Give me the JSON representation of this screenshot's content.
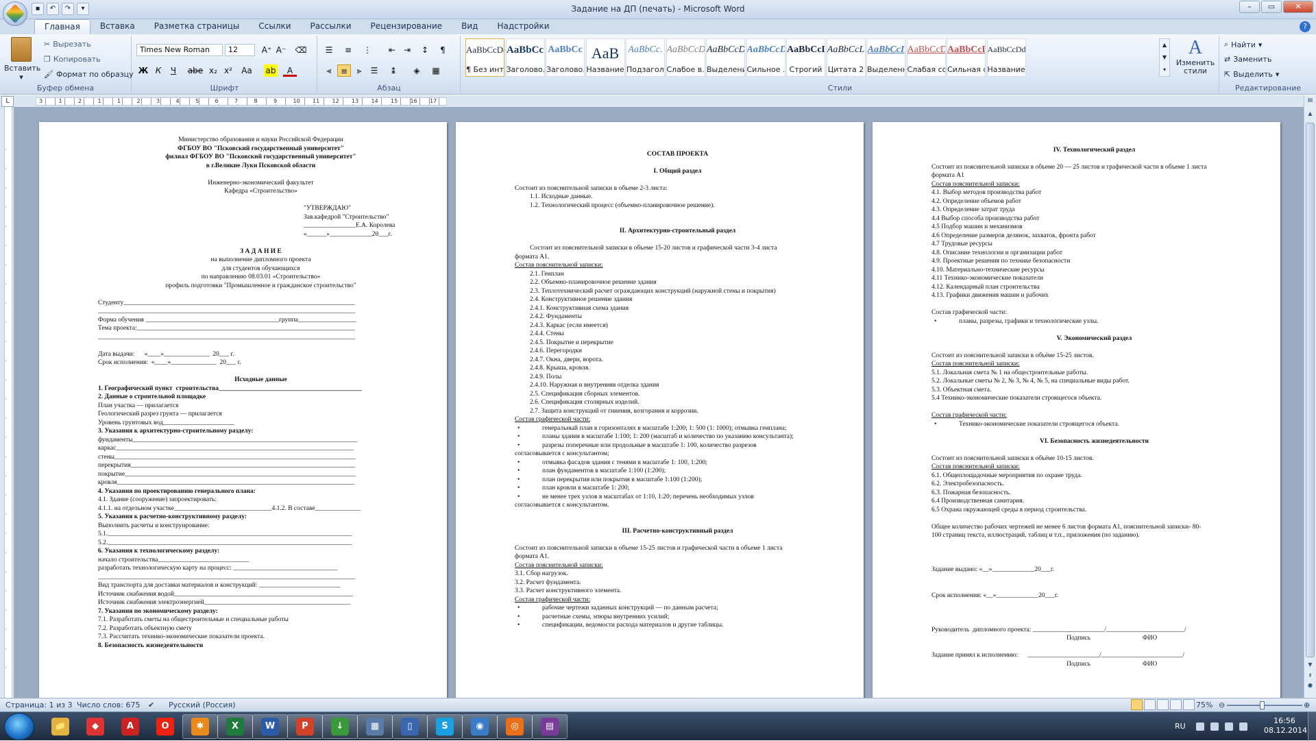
{
  "window": {
    "title": "Задание на ДП (печать) - Microsoft Word"
  },
  "tabs": [
    "Главная",
    "Вставка",
    "Разметка страницы",
    "Ссылки",
    "Рассылки",
    "Рецензирование",
    "Вид",
    "Надстройки"
  ],
  "ribbon": {
    "clipboard": {
      "label": "Буфер обмена",
      "paste": "Вставить",
      "cut": "Вырезать",
      "copy": "Копировать",
      "format_painter": "Формат по образцу"
    },
    "font": {
      "label": "Шрифт",
      "family": "Times New Roman",
      "size": "12",
      "buttons": [
        "Ж",
        "К",
        "Ч",
        "abe",
        "x₂",
        "x²",
        "Aa"
      ]
    },
    "paragraph": {
      "label": "Абзац"
    },
    "styles": {
      "label": "Стили",
      "change": "Изменить стили",
      "items": [
        {
          "sample": "AaBbCcDd",
          "name": "¶ Без инте..."
        },
        {
          "sample": "AaBbCc",
          "name": "Заголово..."
        },
        {
          "sample": "AaBbCc",
          "name": "Заголово..."
        },
        {
          "sample": "AaB",
          "name": "Название"
        },
        {
          "sample": "AaBbCc.",
          "name": "Подзагол..."
        },
        {
          "sample": "AaBbCcDd",
          "name": "Слабое в..."
        },
        {
          "sample": "AaBbCcDd",
          "name": "Выделение"
        },
        {
          "sample": "AaBbCcDd",
          "name": "Сильное ..."
        },
        {
          "sample": "AaBbCcDd",
          "name": "Строгий"
        },
        {
          "sample": "AaBbCcL",
          "name": "Цитата 2"
        },
        {
          "sample": "AaBbCcI",
          "name": "Выделенн..."
        },
        {
          "sample": "AaBbCcDdI",
          "name": "Слабая сс..."
        },
        {
          "sample": "AaBbCcDd",
          "name": "Сильная с..."
        },
        {
          "sample": "AaBbCcDd",
          "name": "Название..."
        }
      ]
    },
    "editing": {
      "label": "Редактирование",
      "find": "Найти",
      "replace": "Заменить",
      "select": "Выделить"
    }
  },
  "ruler": {
    "labels": [
      "3",
      "1",
      "2",
      "1",
      "1",
      "2",
      "3",
      "4",
      "5",
      "6",
      "7",
      "8",
      "9",
      "10",
      "11",
      "12",
      "13",
      "14",
      "15",
      "16",
      "17"
    ]
  },
  "page1": [
    {
      "t": "Министерство образования и науки Российской Федерации",
      "c": "c"
    },
    {
      "t": "ФГБОУ ВО \"Псковский государственный университет\"",
      "c": "c b"
    },
    {
      "t": "филиал ФГБОУ ВО \"Псковский государственный университет\"",
      "c": "c b"
    },
    {
      "t": "в г.Великие Луки Псковской области",
      "c": "c b"
    },
    {
      "t": "",
      "c": "sp"
    },
    {
      "t": "Инженерно-экономический факультет",
      "c": "c"
    },
    {
      "t": "Кафедра «Строительство»",
      "c": "c"
    },
    {
      "t": "",
      "c": "sp"
    },
    {
      "t": "\"УТВЕРЖДАЮ\"",
      "c": "right"
    },
    {
      "t": "Зав.кафедрой \"Строительство\"",
      "c": "right"
    },
    {
      "t": "________________Е.А. Королева",
      "c": "right"
    },
    {
      "t": "«______»_____________20___г.",
      "c": "right"
    },
    {
      "t": "",
      "c": "sp"
    },
    {
      "t": "З А Д А Н И Е",
      "c": "c b"
    },
    {
      "t": "на выполнение  дипломного проекта",
      "c": "c"
    },
    {
      "t": "для студентов обучающихся",
      "c": "c"
    },
    {
      "t": "по направлению  08.03.01 «Строительство»",
      "c": "c"
    },
    {
      "t": "профиль подготовки \"Промышленное и гражданское  строительство\"",
      "c": "c"
    },
    {
      "t": "",
      "c": "sp"
    },
    {
      "t": "Студенту_______________________________________________________________________",
      "c": "ln"
    },
    {
      "t": "_______________________________________________________________________________",
      "c": "ln"
    },
    {
      "t": "Форма обучения _________________________________________группа__________________",
      "c": "ln"
    },
    {
      "t": "Тема проекта:___________________________________________________________________",
      "c": "ln"
    },
    {
      "t": "_______________________________________________________________________________",
      "c": "ln"
    },
    {
      "t": "",
      "c": "sp"
    },
    {
      "t": "Дата выдачи:      «____»______________  20___ г.",
      "c": "ln"
    },
    {
      "t": "Срок исполнения:  «____»______________  20___ г.",
      "c": "ln"
    },
    {
      "t": "",
      "c": "sp"
    },
    {
      "t": "Исходные данные",
      "c": "c b"
    },
    {
      "t": "1. Географический пункт  строительства____________________________________________",
      "c": "b ln"
    },
    {
      "t": "2. Данные о строительной площадке",
      "c": "b"
    },
    {
      "t": "План участка — прилагается",
      "c": ""
    },
    {
      "t": "Геологический разрез грунта — прилагается",
      "c": ""
    },
    {
      "t": " Уровень грунтовых вод______________________",
      "c": ""
    },
    {
      "t": "3. Указания к архитектурно-строительному разделу:",
      "c": "b"
    },
    {
      "t": "фундаменты_____________________________________________________________________",
      "c": "ln"
    },
    {
      "t": "каркас_________________________________________________________________________",
      "c": "ln"
    },
    {
      "t": "стены__________________________________________________________________________",
      "c": "ln"
    },
    {
      "t": "перекрытия_____________________________________________________________________",
      "c": "ln"
    },
    {
      "t": "покрытие_______________________________________________________________________",
      "c": "ln"
    },
    {
      "t": "кровля_________________________________________________________________________",
      "c": "ln"
    },
    {
      "t": "4. Указания по проектированию генерального плана:",
      "c": "b"
    },
    {
      "t": "4.1. Здание (сооружение) запроектировать:",
      "c": ""
    },
    {
      "t": "4.1.1. на отдельном участке______________________________4.1.2. В составе______________",
      "c": "ln"
    },
    {
      "t": "5. Указания к расчетно-конструктивному разделу:",
      "c": "b"
    },
    {
      "t": "Выполнить расчеты и конструирование:",
      "c": ""
    },
    {
      "t": "5.1.___________________________________________________________________________",
      "c": "ln"
    },
    {
      "t": "5.2.___________________________________________________________________________",
      "c": "ln"
    },
    {
      "t": "6. Указания к технологическому разделу:",
      "c": "b"
    },
    {
      "t": "начало строительства____________________________",
      "c": ""
    },
    {
      "t": "разработать технологическую карту на процесс: ________________________________",
      "c": "ln"
    },
    {
      "t": "_______________________________________________________________________________",
      "c": "ln"
    },
    {
      "t": "Вид транспорта для доставки материалов и конструкций: _________________________",
      "c": "ln"
    },
    {
      "t": "Источник снабжения водой_______________________________________________________",
      "c": "ln"
    },
    {
      "t": "Источник снабжения электроэнергией_____________________________________________",
      "c": "ln"
    },
    {
      "t": "7. Указания по экономическому разделу:",
      "c": "b"
    },
    {
      "t": "7.1. Разработать сметы на общестроительные и специальные работы",
      "c": ""
    },
    {
      "t": "7.2. Разработать объектную смету",
      "c": ""
    },
    {
      "t": "7.3. Рассчитать технико-экономические показатели проекта.",
      "c": ""
    },
    {
      "t": "8. Безопасность жизнедеятельности",
      "c": "b"
    }
  ],
  "page2": [
    {
      "t": "",
      "c": "sp"
    },
    {
      "t": "СОСТАВ ПРОЕКТА",
      "c": "c b"
    },
    {
      "t": "",
      "c": "sp"
    },
    {
      "t": "I. Общий раздел",
      "c": "c b"
    },
    {
      "t": "",
      "c": "sp"
    },
    {
      "t": "Состоит из пояснительной записки в объеме 2-3 листа:",
      "c": ""
    },
    {
      "t": "1.1. Исходные данные.",
      "c": "ind1"
    },
    {
      "t": "1.2. Технологический процесс (объемно-планировочное решение).",
      "c": "ind1"
    },
    {
      "t": "",
      "c": "sp"
    },
    {
      "t": "",
      "c": "sp"
    },
    {
      "t": "II. Архитектурно-строительный  раздел",
      "c": "c b"
    },
    {
      "t": "",
      "c": "sp"
    },
    {
      "t": "Состоит из пояснительной записки в объеме 15-20 листов и графической части 3-4 листа",
      "c": "ind1"
    },
    {
      "t": "формата А1.",
      "c": ""
    },
    {
      "t": "Состав пояснительной записки:",
      "c": "u"
    },
    {
      "t": "2.1. Генплан",
      "c": "ind1"
    },
    {
      "t": "2.2. Объемно-планировочное решение здания",
      "c": "ind1"
    },
    {
      "t": "2.3. Теплотехнический расчет ограждающих конструкций (наружной стены и покрытия)",
      "c": "ind1"
    },
    {
      "t": "2.4. Конструктивное решение здания",
      "c": "ind1"
    },
    {
      "t": "2.4.1. Конструктивная схема здания",
      "c": "ind1"
    },
    {
      "t": "2.4.2. Фундаменты",
      "c": "ind1"
    },
    {
      "t": "2.4.3. Каркас (если имеется)",
      "c": "ind1"
    },
    {
      "t": "2.4.4. Стены",
      "c": "ind1"
    },
    {
      "t": "2.4.5. Покрытие и перекрытие",
      "c": "ind1"
    },
    {
      "t": "2.4.6. Перегородки",
      "c": "ind1"
    },
    {
      "t": "2.4.7. Окна, двери, ворота.",
      "c": "ind1"
    },
    {
      "t": "2.4.8. Крыша, кровля.",
      "c": "ind1"
    },
    {
      "t": "2.4.9. Полы",
      "c": "ind1"
    },
    {
      "t": "2.4.10. Наружная и внутренняя отделка здания",
      "c": "ind1"
    },
    {
      "t": "2.5. Спецификация сборных элементов.",
      "c": "ind1"
    },
    {
      "t": "2.6. Спецификация столярных изделий.",
      "c": "ind1"
    },
    {
      "t": "2.7. Защита конструкций от гниения, возгорания и коррозии.",
      "c": "ind1"
    },
    {
      "t": "Состав графической части:",
      "c": "u"
    },
    {
      "t": "генеральный план в горизонталях в масштабе 1:200; 1: 500 (1: 1000); отмывка генплана;",
      "c": "bul"
    },
    {
      "t": "планы здания в масштабе 1:100; 1: 200 (масштаб и количество по указанию консультанта);",
      "c": "bul"
    },
    {
      "t": "разрезы поперечные или продольные в масштабе 1: 100, количество разрезов",
      "c": "bul"
    },
    {
      "t": "согласовывается с     консультантом;",
      "c": ""
    },
    {
      "t": "отмывка фасадов здания с тенями в масштабе 1: 100, 1:200;",
      "c": "bul"
    },
    {
      "t": "план фундаментов в масштабе 1:100 (1:200);",
      "c": "bul"
    },
    {
      "t": "план перекрытия или  покрытия в масштабе 1:100 (1:200);",
      "c": "bul"
    },
    {
      "t": "план кровли в масштабе 1: 200;",
      "c": "bul"
    },
    {
      "t": "не менее трех узлов в масштабах от 1:10, 1:20; перечень необходимых узлов",
      "c": "bul"
    },
    {
      "t": "согласовывается с консультантом.",
      "c": ""
    },
    {
      "t": "",
      "c": "sp"
    },
    {
      "t": "",
      "c": "sp"
    },
    {
      "t": "III. Расчетно-конструктивный раздел",
      "c": "c b"
    },
    {
      "t": "",
      "c": "sp"
    },
    {
      "t": "Состоит из пояснительной записки в объеме 15-25 листов и графической части в объеме 1 листа",
      "c": ""
    },
    {
      "t": "формата А1.",
      "c": ""
    },
    {
      "t": "Состав пояснительной записки:",
      "c": "u"
    },
    {
      "t": "3.1. Сбор нагрузок.",
      "c": ""
    },
    {
      "t": "3.2. Расчет фундамента.",
      "c": ""
    },
    {
      "t": "3.3. Расчет конструктивного элемента.",
      "c": ""
    },
    {
      "t": "Состав графической части:",
      "c": "u"
    },
    {
      "t": "рабочие чертежи заданных конструкций — по данным расчета;",
      "c": "bul"
    },
    {
      "t": "расчетные схемы, эпюры внутренних усилий;",
      "c": "bul"
    },
    {
      "t": "спецификации, ведомости расхода материалов и другие таблицы.",
      "c": "bul"
    }
  ],
  "page3": [
    {
      "t": "",
      "c": "sp"
    },
    {
      "t": "IV. Технологический раздел",
      "c": "c b"
    },
    {
      "t": "",
      "c": "sp"
    },
    {
      "t": "Состоит из пояснительной записки в объеме 20 — 25 листов и графической части в объеме 1 листа",
      "c": ""
    },
    {
      "t": "формата А1",
      "c": ""
    },
    {
      "t": "Состав пояснительной записки:",
      "c": "u"
    },
    {
      "t": "4.1. Выбор методов производства работ",
      "c": ""
    },
    {
      "t": "4.2. Определение объемов работ",
      "c": ""
    },
    {
      "t": "4.3. Определение затрат труда",
      "c": ""
    },
    {
      "t": "4.4  Выбор способа производства работ",
      "c": ""
    },
    {
      "t": "4.5  Подбор машин и механизмов",
      "c": ""
    },
    {
      "t": "4.6  Определение размеров делянок, захваток, фронта работ",
      "c": ""
    },
    {
      "t": "4.7  Трудовые ресурсы",
      "c": ""
    },
    {
      "t": "4.8. Описание технологии и организации работ",
      "c": ""
    },
    {
      "t": "4.9. Проектные решения по технике безопасности",
      "c": ""
    },
    {
      "t": "4.10. Материально-технические ресурсы",
      "c": ""
    },
    {
      "t": "4.11  Технико-экономические показатели",
      "c": ""
    },
    {
      "t": "4.12. Календарный план строительства",
      "c": ""
    },
    {
      "t": "4.13. Графики движения машин и рабочих",
      "c": ""
    },
    {
      "t": "",
      "c": "sp"
    },
    {
      "t": "Состав графической части:",
      "c": ""
    },
    {
      "t": "планы, разрезы, графики и технологические узлы.",
      "c": "bul"
    },
    {
      "t": "",
      "c": "sp"
    },
    {
      "t": "V. Экономический раздел",
      "c": "c b"
    },
    {
      "t": "",
      "c": "sp"
    },
    {
      "t": "Состоит из пояснительной записки в объёме 15-25 листов.",
      "c": ""
    },
    {
      "t": "Состав пояснительной записки:",
      "c": "u"
    },
    {
      "t": "5.1. Локальная смета № 1 на общестроительные работы.",
      "c": ""
    },
    {
      "t": "5.2. Локальные сметы № 2, № 3, № 4, № 5, на специальные виды работ.",
      "c": ""
    },
    {
      "t": "5.3. Объектная смета.",
      "c": ""
    },
    {
      "t": "5.4  Технико-экономические показатели строящегося объекта.",
      "c": ""
    },
    {
      "t": "",
      "c": "sp"
    },
    {
      "t": "Состав графической части:",
      "c": "u"
    },
    {
      "t": "Технико-экономические показатели строящегося объекта.",
      "c": "bul"
    },
    {
      "t": "",
      "c": "sp"
    },
    {
      "t": "VI. Безопасность жизнедеятельности",
      "c": "c b"
    },
    {
      "t": "",
      "c": "sp"
    },
    {
      "t": "Состоит из пояснительной записки в объёме 10-15 листов.",
      "c": ""
    },
    {
      "t": "Состав пояснительной записки:",
      "c": "u"
    },
    {
      "t": "6.1. Общеплощадочные мероприятия по охране труда.",
      "c": ""
    },
    {
      "t": "6.2. Электробезопасность.",
      "c": ""
    },
    {
      "t": "6.3. Пожарная безопасность.",
      "c": ""
    },
    {
      "t": "6.4  Производственная санитария.",
      "c": ""
    },
    {
      "t": "6.5 Охрана окружающей среды в период строительства.",
      "c": ""
    },
    {
      "t": "",
      "c": "sp"
    },
    {
      "t": "Общее количество рабочих чертежей не менее 6 листов формата А1, пояснительной записки- 80-",
      "c": ""
    },
    {
      "t": "100 страниц текста, иллюстраций, таблиц и т.п., приложения (по заданию).",
      "c": ""
    },
    {
      "t": "",
      "c": "sp"
    },
    {
      "t": "",
      "c": "sp"
    },
    {
      "t": "",
      "c": "sp"
    },
    {
      "t": "Задание выдано:    «__»_____________20___г.",
      "c": ""
    },
    {
      "t": "",
      "c": "sp"
    },
    {
      "t": "",
      "c": "sp"
    },
    {
      "t": "Срок исполнения: «__»_____________20___г.",
      "c": ""
    },
    {
      "t": "",
      "c": "sp"
    },
    {
      "t": "",
      "c": "sp"
    },
    {
      "t": "",
      "c": "sp"
    },
    {
      "t": "Руководитель  дипломного проекта: ______________________/________________________/",
      "c": "ln"
    },
    {
      "t": "                                                                                   Подпись                                ФИО",
      "c": "ln"
    },
    {
      "t": "",
      "c": "sp"
    },
    {
      "t": "Задание принял к исполнению:      ______________________/_________________________/",
      "c": "ln"
    },
    {
      "t": "                                                                                   Подпись                                ФИО",
      "c": "ln"
    }
  ],
  "status": {
    "page": "Страница: 1 из 3",
    "words": "Число слов: 675",
    "lang": "Русский (Россия)",
    "zoom": "75%",
    "zoom_level": 0.75
  },
  "taskbar": {
    "lang": "RU",
    "time": "16:56",
    "date": "08.12.2014",
    "apps": [
      {
        "name": "explorer",
        "glyph": "📁",
        "color": "#e3b341"
      },
      {
        "name": "app-red",
        "glyph": "◆",
        "color": "#d33"
      },
      {
        "name": "autocad",
        "glyph": "A",
        "color": "#c22"
      },
      {
        "name": "opera",
        "glyph": "O",
        "color": "#e21"
      },
      {
        "name": "app-star",
        "glyph": "✱",
        "color": "#e98a1a"
      },
      {
        "name": "excel",
        "glyph": "X",
        "color": "#1f7a3c"
      },
      {
        "name": "word",
        "glyph": "W",
        "color": "#2a5aa8"
      },
      {
        "name": "presentation",
        "glyph": "P",
        "color": "#d0422a"
      },
      {
        "name": "download",
        "glyph": "↓",
        "color": "#3a9a3a"
      },
      {
        "name": "calculator",
        "glyph": "▦",
        "color": "#5a7aa8"
      },
      {
        "name": "devices",
        "glyph": "▯",
        "color": "#3b66b0"
      },
      {
        "name": "skype",
        "glyph": "S",
        "color": "#1aa0e0"
      },
      {
        "name": "browser",
        "glyph": "◉",
        "color": "#3a7cc7"
      },
      {
        "name": "firefox",
        "glyph": "◎",
        "color": "#e8701a"
      },
      {
        "name": "winrar",
        "glyph": "▤",
        "color": "#7a3a9a"
      }
    ]
  }
}
